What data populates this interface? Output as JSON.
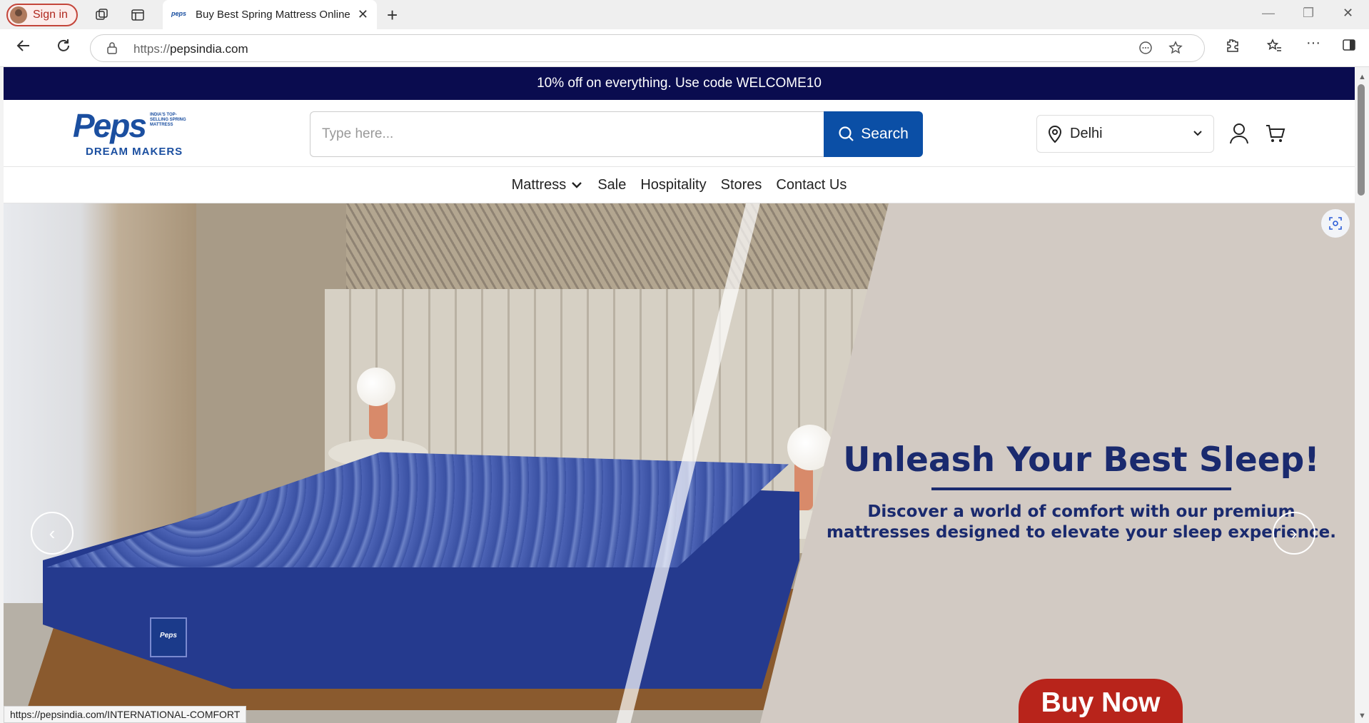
{
  "browser": {
    "signin_label": "Sign in",
    "tab_title": "Buy Best Spring Mattress Online -",
    "tab_favicon_text": "peps",
    "url_protocol": "https://",
    "url_host": "pepsindia.com",
    "status_url": "https://pepsindia.com/INTERNATIONAL-COMFORT"
  },
  "promo": {
    "text": "10% off on everything. Use code WELCOME10"
  },
  "logo": {
    "brand": "Peps",
    "tagline": "INDIA'S TOP-SELLING SPRING MATTRESS",
    "subbrand": "DREAM MAKERS"
  },
  "search": {
    "placeholder": "Type here...",
    "button_label": "Search"
  },
  "location": {
    "city": "Delhi"
  },
  "menu": {
    "items": [
      "Mattress",
      "Sale",
      "Hospitality",
      "Stores",
      "Contact Us"
    ]
  },
  "hero": {
    "headline": "Unleash Your Best Sleep!",
    "subtext": "Discover a world of comfort with our premium mattresses designed to elevate your sleep experience.",
    "cta_label": "Buy Now",
    "mattress_badge": "Peps"
  },
  "colors": {
    "promo_bg": "#0a0c4f",
    "brand_blue": "#0b4fa6",
    "headline_navy": "#1a2a6e",
    "cta_red": "#b8241b"
  }
}
